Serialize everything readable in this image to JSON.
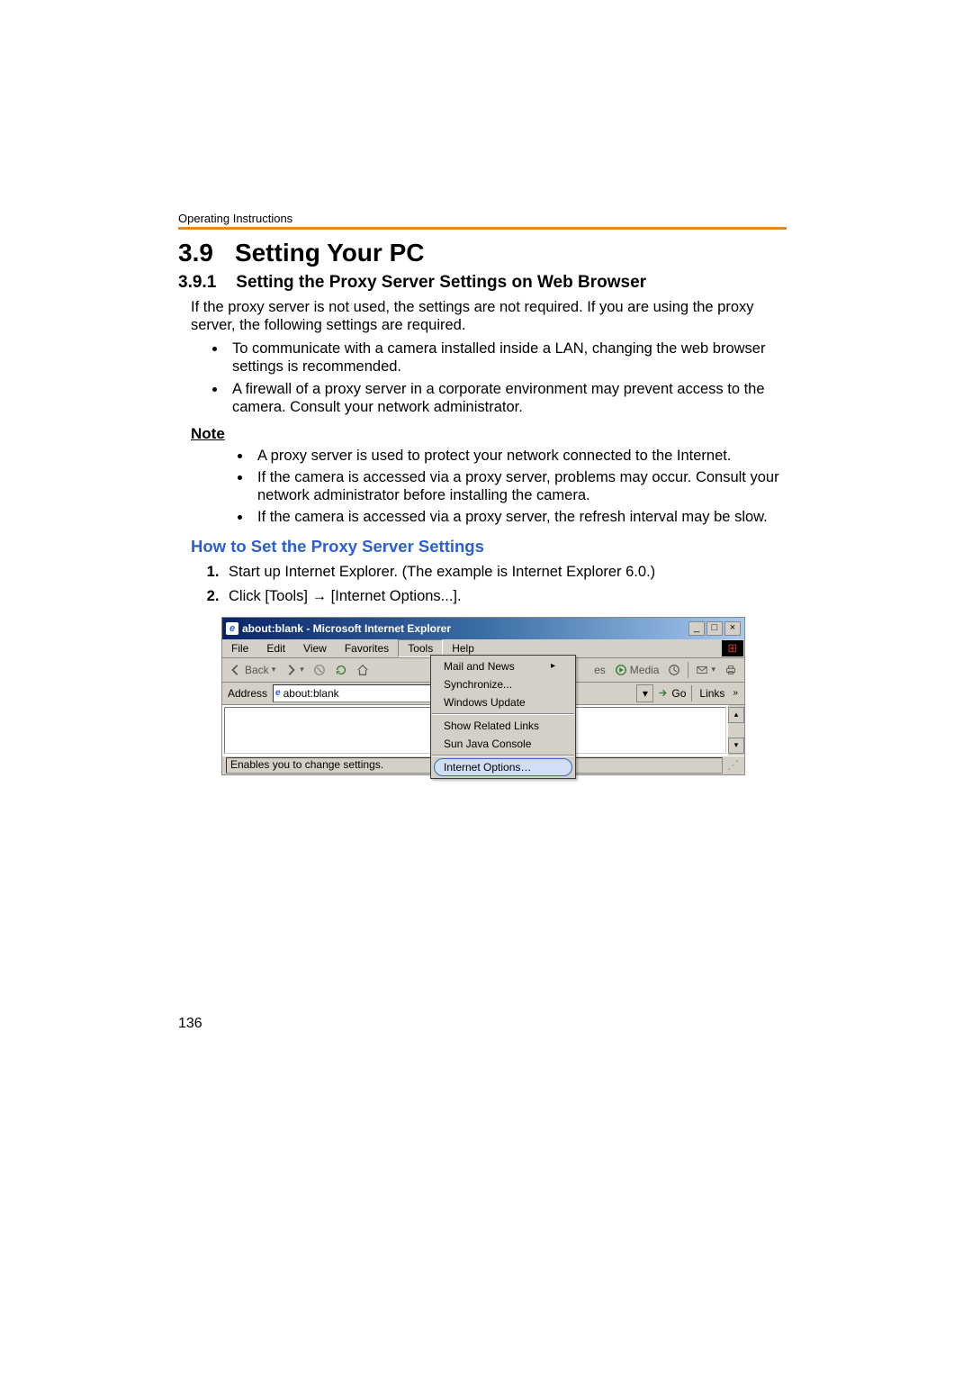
{
  "running_header": "Operating Instructions",
  "section": {
    "num": "3.9",
    "title": "Setting Your PC"
  },
  "subsection": {
    "num": "3.9.1",
    "title": "Setting the Proxy Server Settings on Web Browser"
  },
  "intro": "If the proxy server is not used, the settings are not required. If you are using the proxy server, the following settings are required.",
  "intro_bullets": [
    "To communicate with a camera installed inside a LAN, changing the web browser settings is recommended.",
    "A firewall of a proxy server in a corporate environment may prevent access to the camera. Consult your network administrator."
  ],
  "note_heading": "Note",
  "note_bullets": [
    "A proxy server is used to protect your network connected to the Internet.",
    "If the camera is accessed via a proxy server, problems may occur. Consult your network administrator before installing the camera.",
    "If the camera is accessed via a proxy server, the refresh interval may be slow."
  ],
  "howto_heading": "How to Set the Proxy Server Settings",
  "steps": [
    "Start up Internet Explorer. (The example is Internet Explorer 6.0.)",
    "Click [Tools] → [Internet Options...]."
  ],
  "ie": {
    "title": "about:blank - Microsoft Internet Explorer",
    "menu": [
      "File",
      "Edit",
      "View",
      "Favorites",
      "Tools",
      "Help"
    ],
    "toolbar": {
      "back": "Back",
      "favorites": "es",
      "media": "Media"
    },
    "address_label": "Address",
    "address_value": "about:blank",
    "go_label": "Go",
    "links_label": "Links",
    "dropdown": {
      "items_top": [
        "Mail and News",
        "Synchronize...",
        "Windows Update"
      ],
      "items_mid": [
        "Show Related Links",
        "Sun Java Console"
      ],
      "selected": "Internet Options…"
    },
    "status": "Enables you to change settings."
  },
  "page_number": "136"
}
